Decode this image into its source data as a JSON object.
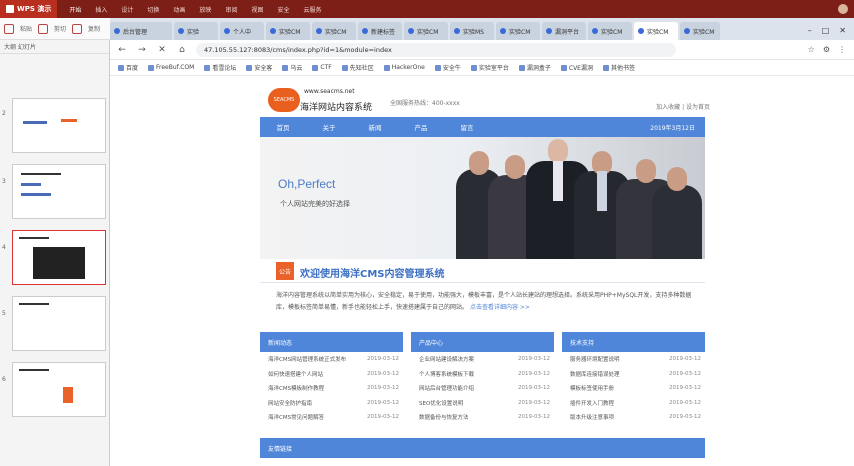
{
  "wps": {
    "app_name": "WPS 演示",
    "menu": [
      "开始",
      "插入",
      "设计",
      "切换",
      "动画",
      "放映",
      "审阅",
      "视图",
      "安全",
      "云服务"
    ]
  },
  "ribbon": {
    "items": [
      "粘贴",
      "剪切",
      "复制"
    ]
  },
  "slides_panel": {
    "tabs": [
      "大纲",
      "幻灯片"
    ],
    "numbers": [
      "2",
      "3",
      "4",
      "5",
      "6"
    ]
  },
  "browser": {
    "tabs": [
      "后台管理",
      "实验",
      "个人中",
      "实验CM",
      "实验CM",
      "新建标签",
      "实验CM",
      "实验MS",
      "实验CM",
      "漏洞平台",
      "实验CM",
      "实验CM",
      "实验CM"
    ],
    "url": "47.105.55.127:8083/cms/index.php?id=1&module=index",
    "bookmarks": [
      "百度",
      "FreeBuf.COM",
      "看雪论坛",
      "安全客",
      "乌云",
      "CTF",
      "先知社区",
      "HackerOne",
      "安全牛",
      "实验室平台",
      "漏洞盒子",
      "CVE漏洞",
      "其他书签"
    ]
  },
  "site": {
    "logo_badge": "SEACMS",
    "logo_url": "www.seacms.net",
    "logo_name": "海洋网站内容系统",
    "tel": "全国服务热线：400-xxxx",
    "head_right": "加入收藏 | 设为首页",
    "nav": [
      "首页",
      "关于",
      "新闻",
      "产品",
      "留言"
    ],
    "nav_date": "2019年3月12日",
    "banner_title": "Oh,Perfect",
    "banner_sub": "个人网站完美的好选择",
    "welcome_icon": "公告",
    "welcome_title": "欢迎使用海洋CMS内容管理系统",
    "intro": "海洋内容管理系统以简单实用为核心，安全稳定，易于使用，功能强大，模板丰富，是个人站长建站的理想选择。系统采用PHP+MySQL开发，支持多种数据库，模板标签简单易懂，新手也能轻松上手，快速搭建属于自己的网站。",
    "intro_more": "点击查看详细内容 >>",
    "columns": [
      {
        "title": "新闻动态",
        "rows": [
          {
            "t": "海洋CMS网站管理系统正式发布",
            "d": "2019-03-12"
          },
          {
            "t": "如何快速搭建个人网站",
            "d": "2019-03-12"
          },
          {
            "t": "海洋CMS模板制作教程",
            "d": "2019-03-12"
          },
          {
            "t": "网站安全防护指南",
            "d": "2019-03-12"
          },
          {
            "t": "海洋CMS常见问题解答",
            "d": "2019-03-12"
          }
        ]
      },
      {
        "title": "产品中心",
        "rows": [
          {
            "t": "企业网站建设解决方案",
            "d": "2019-03-12"
          },
          {
            "t": "个人博客系统模板下载",
            "d": "2019-03-12"
          },
          {
            "t": "网站后台管理功能介绍",
            "d": "2019-03-12"
          },
          {
            "t": "SEO优化设置说明",
            "d": "2019-03-12"
          },
          {
            "t": "数据备份与恢复方法",
            "d": "2019-03-12"
          }
        ]
      },
      {
        "title": "技术支持",
        "rows": [
          {
            "t": "服务器环境配置说明",
            "d": "2019-03-12"
          },
          {
            "t": "数据库连接错误处理",
            "d": "2019-03-12"
          },
          {
            "t": "模板标签使用手册",
            "d": "2019-03-12"
          },
          {
            "t": "插件开发入门教程",
            "d": "2019-03-12"
          },
          {
            "t": "版本升级注意事项",
            "d": "2019-03-12"
          }
        ]
      }
    ],
    "footer_title": "友情链接"
  },
  "colors": {
    "brand_blue": "#4f86d9",
    "accent_orange": "#e8622a",
    "wps_red": "#7d1f16"
  }
}
